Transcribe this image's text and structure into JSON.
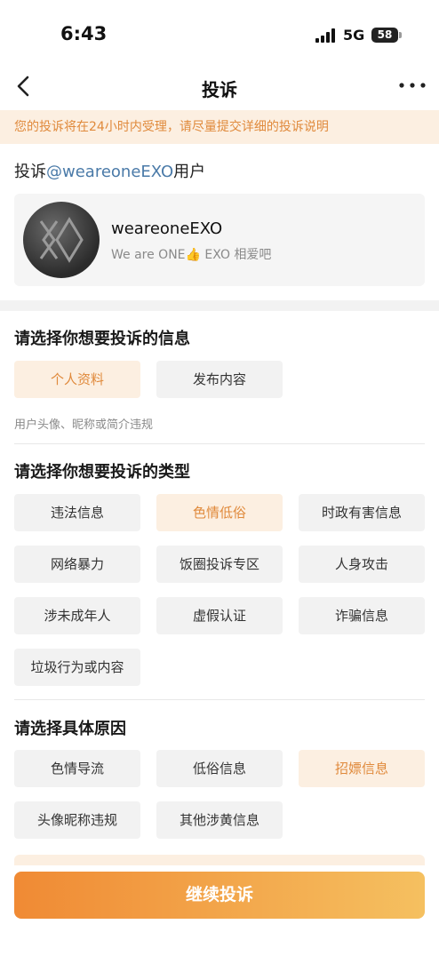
{
  "status_bar": {
    "time": "6:43",
    "network": "5G",
    "battery": "58"
  },
  "nav": {
    "title": "投诉",
    "back_icon": "chevron-left-icon",
    "more_icon": "more-dots-icon"
  },
  "notice": "您的投诉将在24小时内受理，请尽量提交详细的投诉说明",
  "target": {
    "prefix": "投诉",
    "handle": "@weareoneEXO",
    "suffix": "用户"
  },
  "user_card": {
    "name": "weareoneEXO",
    "bio": "We are ONE👍 EXO 相爱吧"
  },
  "info_section": {
    "title": "请选择你想要投诉的信息",
    "options": [
      "个人资料",
      "发布内容"
    ],
    "selected": "个人资料",
    "hint": "用户头像、昵称或简介违规"
  },
  "type_section": {
    "title": "请选择你想要投诉的类型",
    "options": [
      "违法信息",
      "色情低俗",
      "时政有害信息",
      "网络暴力",
      "饭圈投诉专区",
      "人身攻击",
      "涉未成年人",
      "虚假认证",
      "诈骗信息",
      "垃圾行为或内容"
    ],
    "selected": "色情低俗"
  },
  "reason_section": {
    "title": "请选择具体原因",
    "options": [
      "色情导流",
      "低俗信息",
      "招嫖信息",
      "头像昵称违规",
      "其他涉黄信息"
    ],
    "selected": "招嫖信息"
  },
  "submit_label": "继续投诉",
  "colors": {
    "accent": "#e08a3c",
    "accent_bg": "#fcefe1",
    "link": "#4a7aa8"
  }
}
